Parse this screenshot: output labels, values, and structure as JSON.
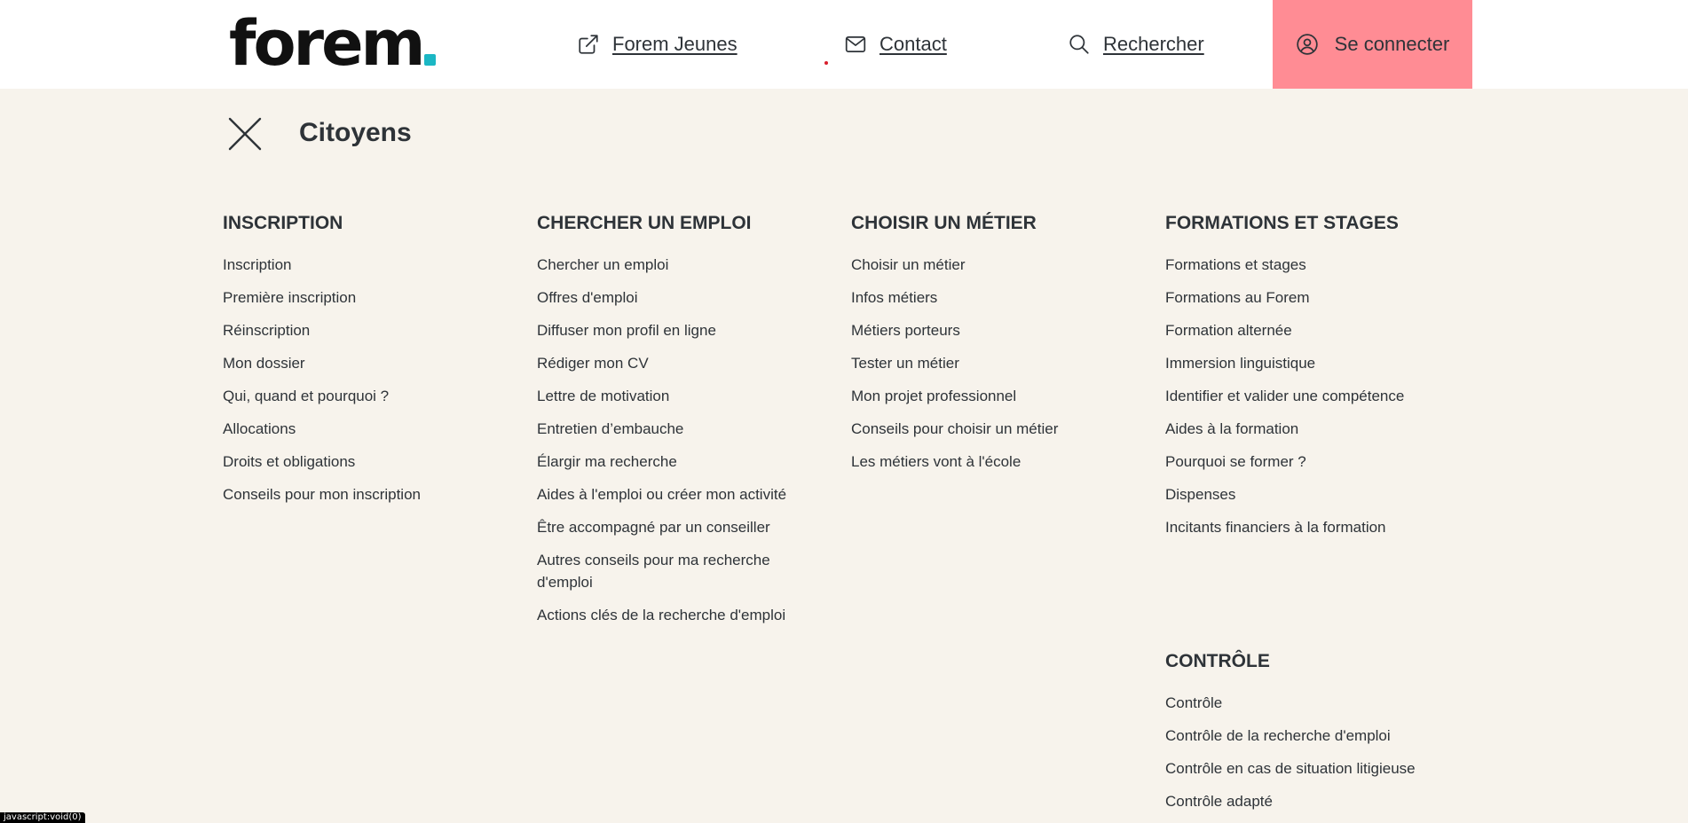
{
  "header": {
    "logo_text": "forem",
    "brand_color": "#1bb7c4",
    "nav": {
      "jeunes_label": "Forem Jeunes",
      "contact_label": "Contact",
      "search_label": "Rechercher"
    },
    "login_label": "Se connecter",
    "login_color": "#ff8c94"
  },
  "section": {
    "title": "Citoyens"
  },
  "columns": [
    {
      "heading": "INSCRIPTION",
      "links": [
        "Inscription",
        "Première inscription",
        "Réinscription",
        "Mon dossier",
        "Qui, quand et pourquoi ?",
        "Allocations",
        "Droits et obligations",
        "Conseils pour mon inscription"
      ]
    },
    {
      "heading": "CHERCHER UN EMPLOI",
      "links": [
        "Chercher un emploi",
        "Offres d'emploi",
        "Diffuser mon profil en ligne",
        "Rédiger mon CV",
        "Lettre de motivation",
        "Entretien d’embauche",
        "Élargir ma recherche",
        "Aides à l'emploi ou créer mon activité",
        "Être accompagné par un conseiller",
        "Autres conseils pour ma recherche d'emploi",
        "Actions clés de la recherche d'emploi"
      ]
    },
    {
      "heading": "CHOISIR UN MÉTIER",
      "links": [
        "Choisir un métier",
        "Infos métiers",
        "Métiers porteurs",
        "Tester un métier",
        "Mon projet professionnel",
        "Conseils pour choisir un métier",
        "Les métiers vont à l'école"
      ]
    },
    {
      "heading": "FORMATIONS ET STAGES",
      "links": [
        "Formations et stages",
        "Formations au Forem",
        "Formation alternée",
        "Immersion linguistique",
        "Identifier et valider une compétence",
        "Aides à la formation",
        "Pourquoi se former ?",
        "Dispenses",
        "Incitants financiers à la formation"
      ]
    },
    {
      "heading": "CONTRÔLE",
      "links": [
        "Contrôle",
        "Contrôle de la recherche d'emploi",
        "Contrôle en cas de situation litigieuse",
        "Contrôle adapté"
      ]
    }
  ],
  "status_bar": {
    "text": "javascript:void(0)"
  }
}
